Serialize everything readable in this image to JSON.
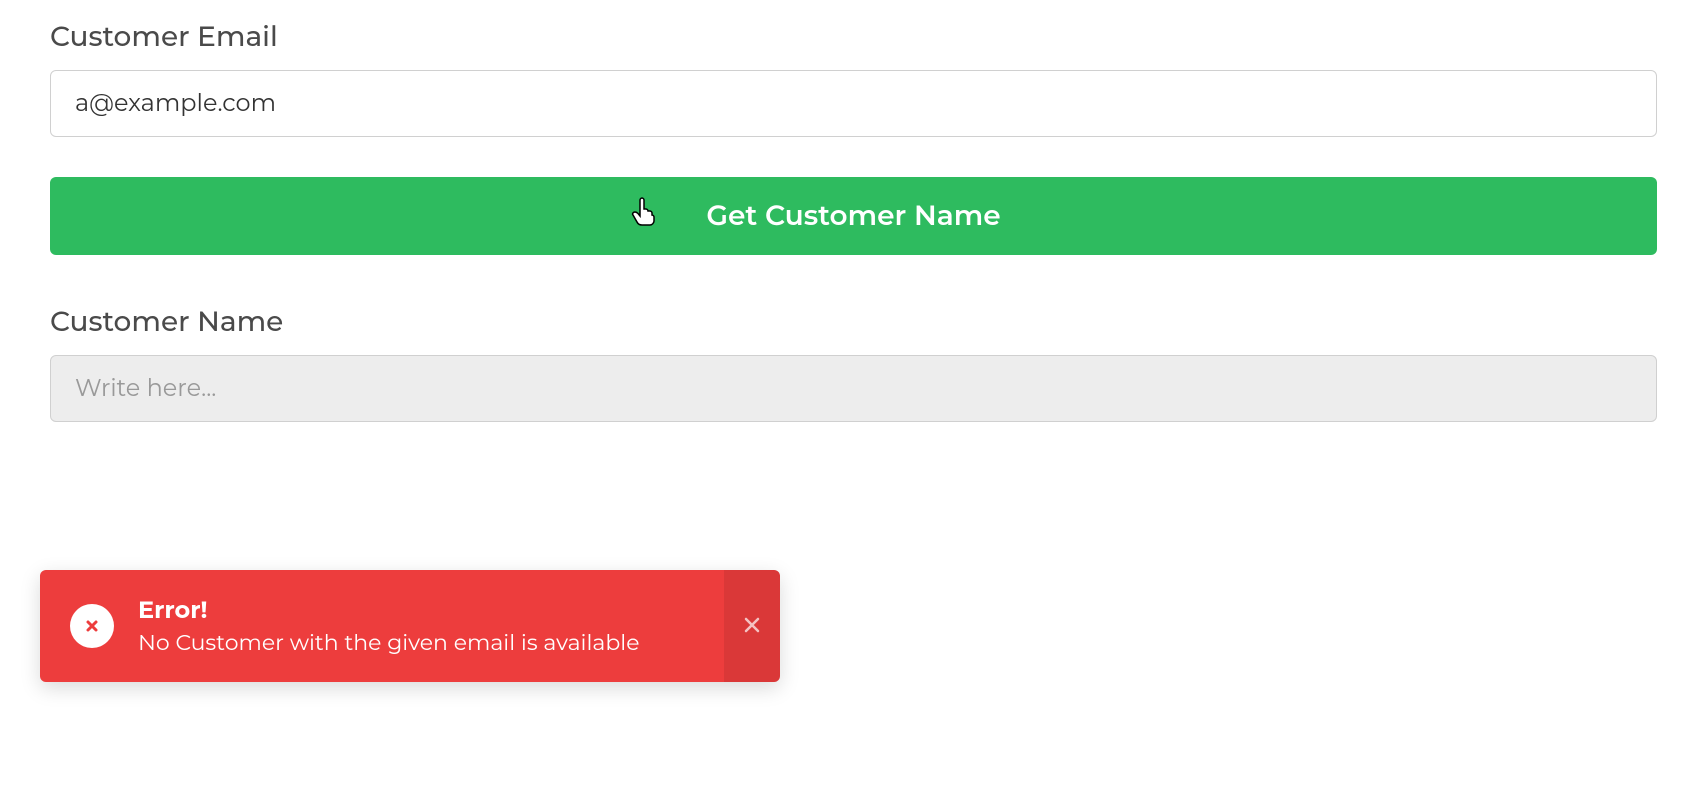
{
  "form": {
    "email_label": "Customer Email",
    "email_value": "a@example.com",
    "get_name_button": "Get Customer Name",
    "name_label": "Customer Name",
    "name_value": "",
    "name_placeholder": "Write here..."
  },
  "toast": {
    "title": "Error!",
    "message": "No Customer with the given email is available"
  },
  "colors": {
    "primary_button": "#2ebb5f",
    "error": "#ed3d3d"
  }
}
